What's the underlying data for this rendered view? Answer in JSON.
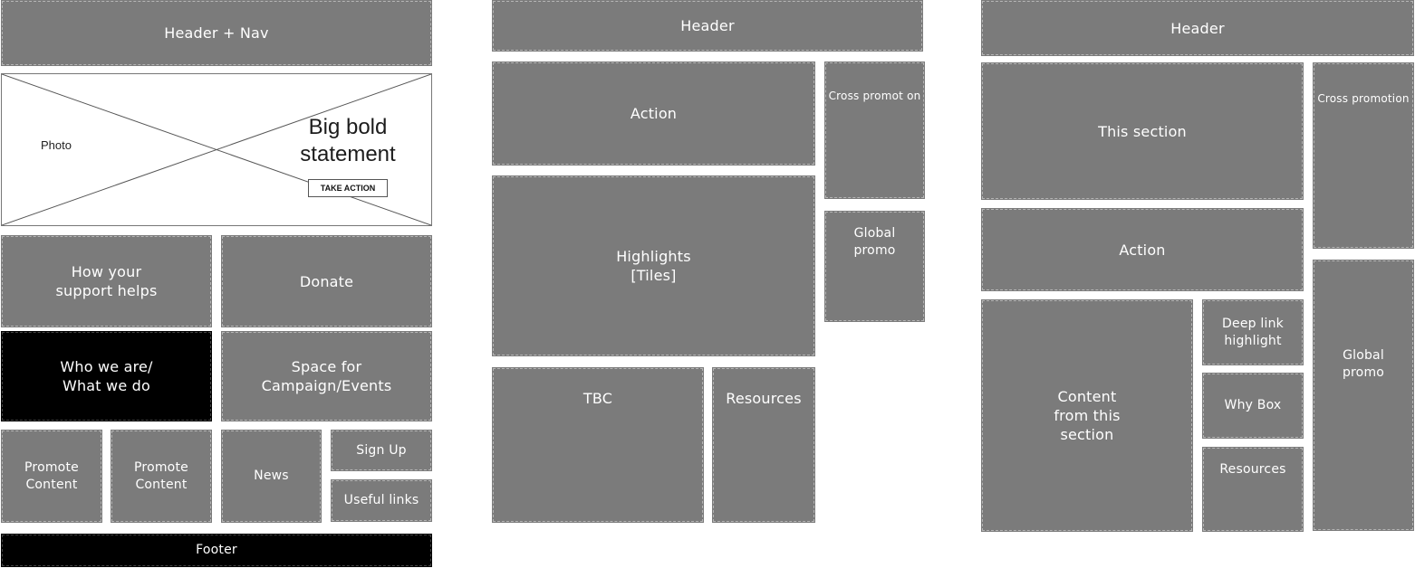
{
  "column1": {
    "header": "Header + Nav",
    "hero": {
      "photo_label": "Photo",
      "statement": "Big bold\nstatement",
      "button_label": "TAKE ACTION"
    },
    "support": "How your\nsupport helps",
    "donate": "Donate",
    "who_we_are": "Who we are/\nWhat we do",
    "campaign": "Space for\nCampaign/Events",
    "promote_1": "Promote\nContent",
    "promote_2": "Promote\nContent",
    "news": "News",
    "sign_up": "Sign Up",
    "useful_links": "Useful links",
    "footer": "Footer"
  },
  "column2": {
    "header": "Header",
    "action": "Action",
    "cross_promotion": "Cross  promot on",
    "highlights": "Highlights\n[Tiles]",
    "global_promo": "Global\npromo",
    "tbc": "TBC",
    "resources": "Resources"
  },
  "column3": {
    "header": "Header",
    "this_section": "This section",
    "cross_promotion": "Cross  promotion",
    "action": "Action",
    "content": "Content\nfrom this\nsection",
    "deep_link": "Deep link\nhighlight",
    "why_box": "Why Box",
    "resources": "Resources",
    "global_promo": "Global\npromo"
  }
}
